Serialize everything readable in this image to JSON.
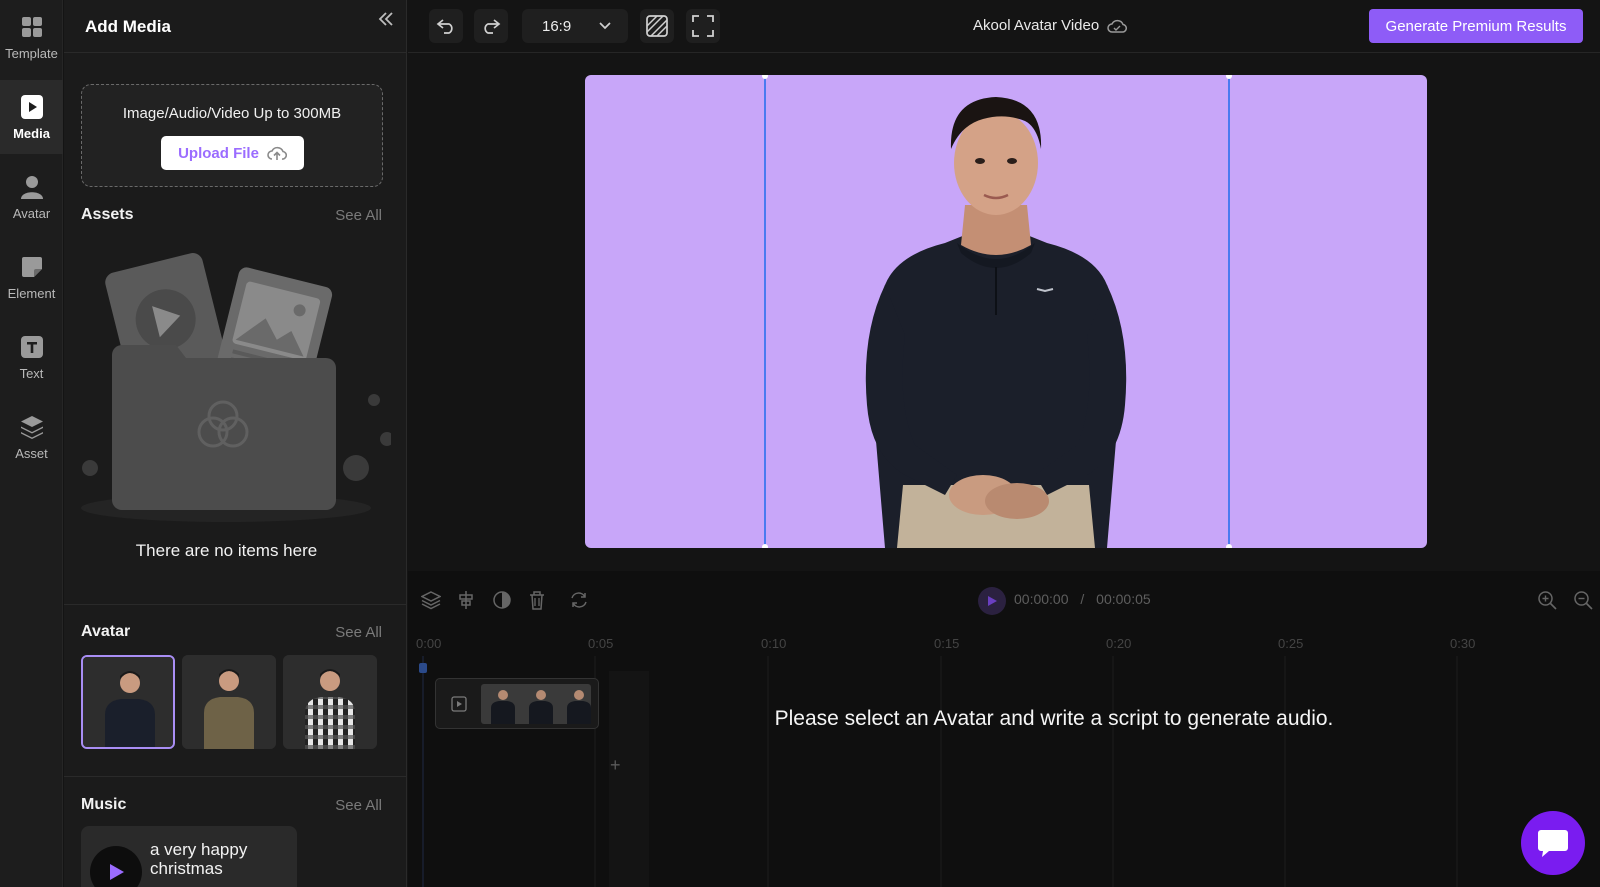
{
  "rail": {
    "items": [
      {
        "label": "Template",
        "icon": "template-grid-icon"
      },
      {
        "label": "Media",
        "icon": "media-play-icon",
        "active": true
      },
      {
        "label": "Avatar",
        "icon": "avatar-person-icon"
      },
      {
        "label": "Element",
        "icon": "element-shape-icon"
      },
      {
        "label": "Text",
        "icon": "text-t-icon"
      },
      {
        "label": "Asset",
        "icon": "asset-layers-icon"
      }
    ]
  },
  "panel": {
    "title": "Add Media",
    "upload": {
      "hint": "Image/Audio/Video Up to 300MB",
      "button": "Upload File"
    },
    "assets": {
      "title": "Assets",
      "see_all": "See All",
      "empty": "There are no items here"
    },
    "avatar": {
      "title": "Avatar",
      "see_all": "See All",
      "shirt_colors": [
        "#1a1f2b",
        "#6e6247",
        "#e6e6e6"
      ]
    },
    "music": {
      "title": "Music",
      "see_all": "See All",
      "track_name": "a very happy christmas"
    }
  },
  "topbar": {
    "aspect_ratio": "16:9",
    "project_title": "Akool Avatar Video",
    "generate_button": "Generate Premium Results"
  },
  "timeline": {
    "current_time": "00:00:00",
    "separator": "/",
    "total_time": "00:00:05",
    "ruler": [
      "0:00",
      "0:05",
      "0:10",
      "0:15",
      "0:20",
      "0:25",
      "0:30"
    ],
    "message": "Please select an Avatar and write a script to generate audio."
  },
  "colors": {
    "accent": "#8e5cf7",
    "canvas_bg": "#c8a6f9",
    "chat_button": "#7a1cf0"
  }
}
